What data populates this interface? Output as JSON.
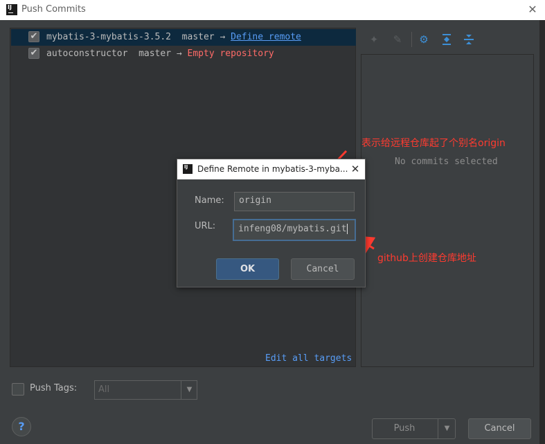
{
  "window": {
    "title": "Push Commits"
  },
  "repos": [
    {
      "name": "mybatis-3-mybatis-3.5.2",
      "branch": "master",
      "arrow": "→",
      "target": "Define remote"
    },
    {
      "name": "autoconstructor",
      "branch": "master",
      "arrow": "→",
      "target": "Empty repository"
    }
  ],
  "edit_targets": "Edit all targets",
  "commits": {
    "empty_text": "No commits selected"
  },
  "bottom": {
    "push_tags_label": "Push Tags:",
    "push_tags_value": "All",
    "push_button": "Push",
    "cancel_button": "Cancel",
    "help": "?"
  },
  "dialog": {
    "title": "Define Remote in mybatis-3-myba...",
    "name_label": "Name:",
    "name_value": "origin",
    "url_label": "URL:",
    "url_value": "infeng08/mybatis.git",
    "ok": "OK",
    "cancel": "Cancel"
  },
  "annotations": {
    "remote_alias": "表示给远程仓库起了个别名origin",
    "github_url": "github上创建仓库地址"
  },
  "colors": {
    "link": "#589df6",
    "empty_repo": "#ff6b68",
    "annotation": "#ff3b30",
    "selected_row": "#0d293e"
  }
}
